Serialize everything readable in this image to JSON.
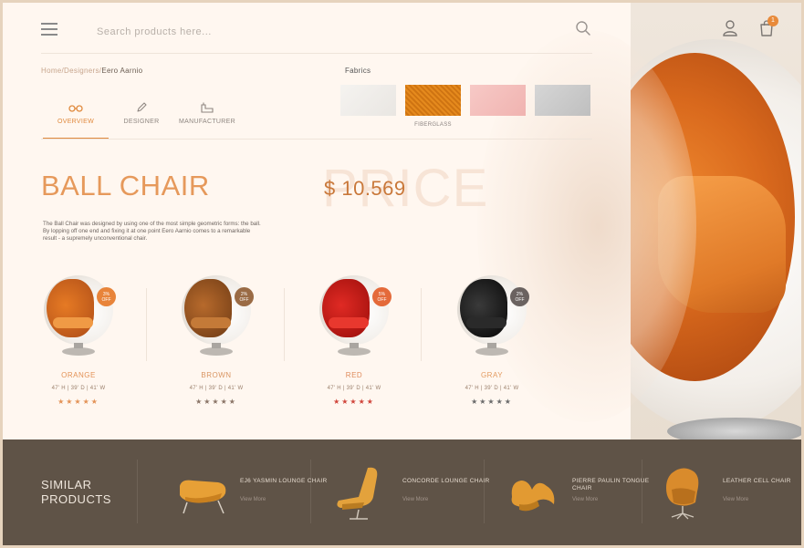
{
  "header": {
    "search_placeholder": "Search products here...",
    "cart_count": "1"
  },
  "breadcrumb": {
    "path": "Home/Designers/",
    "current": "Eero Aarnio"
  },
  "tabs": [
    {
      "label": "OVERVIEW",
      "icon": "glasses-icon",
      "active": true
    },
    {
      "label": "DESIGNER",
      "icon": "pencil-icon",
      "active": false
    },
    {
      "label": "MANUFACTURER",
      "icon": "factory-icon",
      "active": false
    }
  ],
  "fabrics": {
    "title": "Fabrics",
    "selected_label": "FIBERGLASS"
  },
  "product": {
    "title": "BALL CHAIR",
    "price": "$ 10.569",
    "price_watermark": "PRICE",
    "description": "The Ball Chair was designed by using one of the most simple geometric forms: the ball. By lopping off one end and fixing it at one point Eero Aarnio comes to a remarkable result - a supremely unconventional chair."
  },
  "variants": [
    {
      "name": "ORANGE",
      "dims": "47' H | 39' D | 41' W",
      "discount": "3%\nOFF",
      "stars": "★★★★★",
      "name_color": "#e39256",
      "star_color": "#e39256",
      "badge_color": "#e8843a"
    },
    {
      "name": "BROWN",
      "dims": "47' H | 39' D | 41' W",
      "discount": "2%\nOFF",
      "stars": "★★★★★",
      "name_color": "#d99562",
      "star_color": "#8a7466",
      "badge_color": "#9a6b45"
    },
    {
      "name": "RED",
      "dims": "47' H | 39' D | 41' W",
      "discount": "5%\nOFF",
      "stars": "★★★★★",
      "name_color": "#df8a5a",
      "star_color": "#d0443a",
      "badge_color": "#e46a3a"
    },
    {
      "name": "GRAY",
      "dims": "47' H | 39' D | 41' W",
      "discount": "2%\nOFF",
      "stars": "★★★★★",
      "name_color": "#e39b60",
      "star_color": "#6a6a6a",
      "badge_color": "#6a6260"
    }
  ],
  "similar": {
    "title_line1": "SIMILAR",
    "title_line2": "PRODUCTS",
    "items": [
      {
        "name": "EJ6 YASMIN LOUNGE CHAIR",
        "more": "View More"
      },
      {
        "name": "CONCORDE LOUNGE CHAIR",
        "more": "View More"
      },
      {
        "name": "PIERRE PAULIN TONGUE CHAIR",
        "more": "View More"
      },
      {
        "name": "LEATHER CELL CHAIR",
        "more": "View More"
      }
    ]
  },
  "colors": {
    "accent": "#e08a3e",
    "bottom_bar": "#5f5347"
  }
}
